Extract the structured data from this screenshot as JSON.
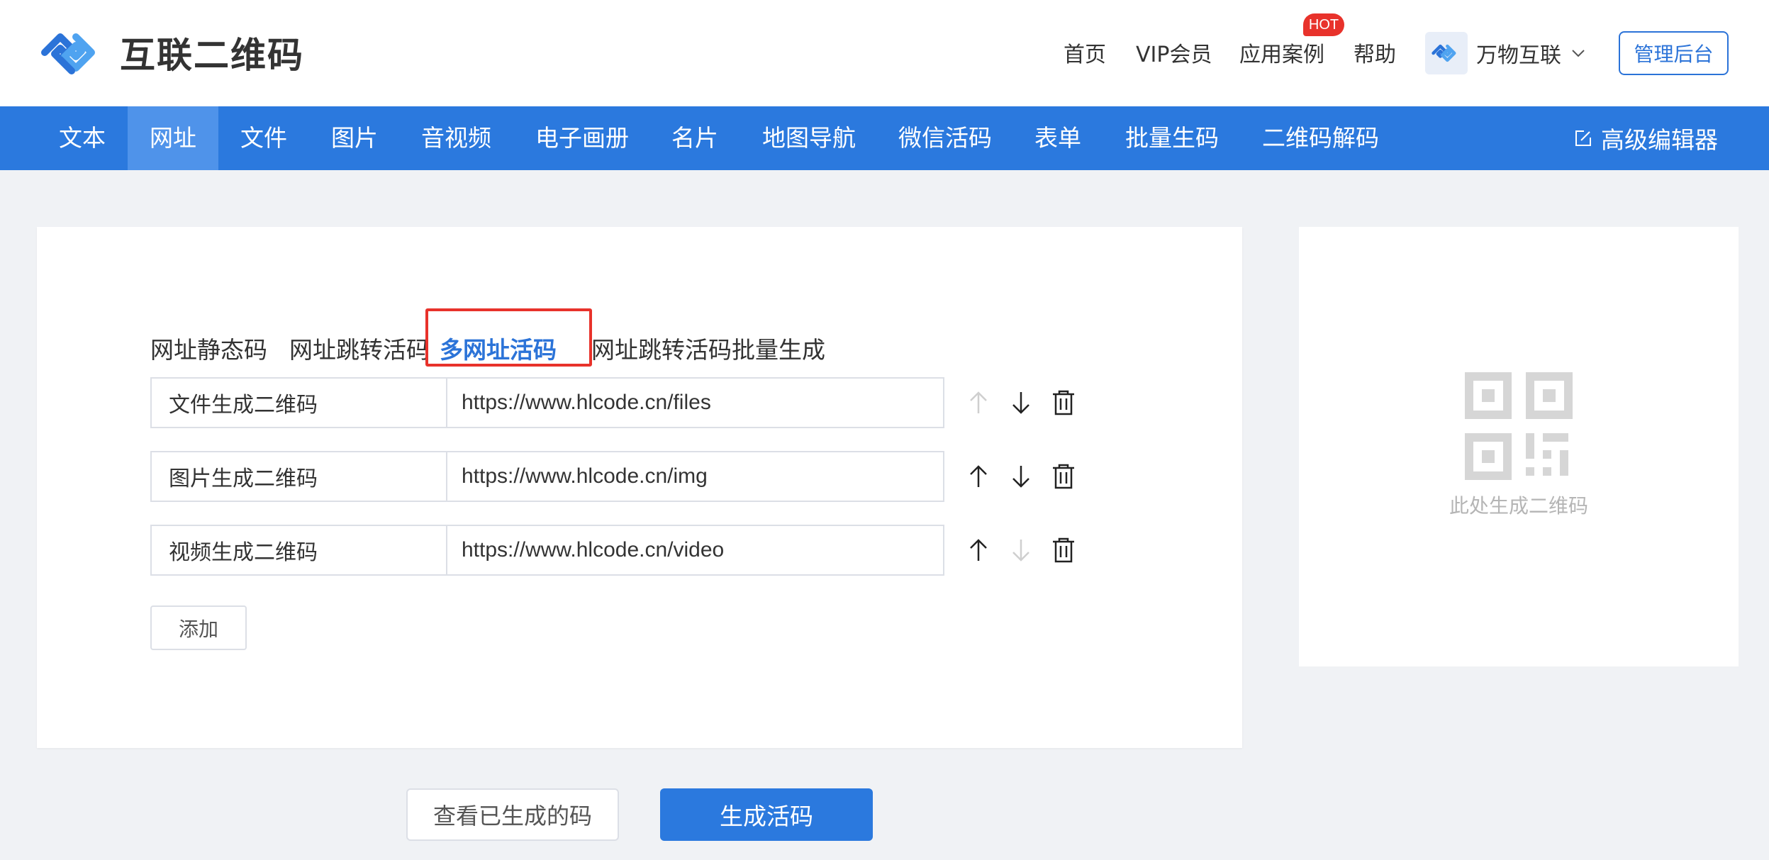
{
  "brand": {
    "name": "互联二维码",
    "accent": "#2b79de",
    "logo_icon": "chain-link-logo-icon"
  },
  "topnav": {
    "items": [
      "首页",
      "VIP会员",
      "应用案例",
      "帮助"
    ],
    "hot_badge": "HOT",
    "user_name": "万物互联",
    "admin_button": "管理后台"
  },
  "mainnav": {
    "items": [
      "文本",
      "网址",
      "文件",
      "图片",
      "音视频",
      "电子画册",
      "名片",
      "地图导航",
      "微信活码",
      "表单",
      "批量生码",
      "二维码解码"
    ],
    "active": "网址",
    "advanced_editor": "高级编辑器"
  },
  "subtabs": {
    "items": [
      "网址静态码",
      "网址跳转活码",
      "多网址活码",
      "网址跳转活码批量生成"
    ],
    "active": "多网址活码"
  },
  "rows": [
    {
      "name": "文件生成二维码",
      "url": "https://www.hlcode.cn/files",
      "up_enabled": false,
      "down_enabled": true
    },
    {
      "name": "图片生成二维码",
      "url": "https://www.hlcode.cn/img",
      "up_enabled": true,
      "down_enabled": true
    },
    {
      "name": "视频生成二维码",
      "url": "https://www.hlcode.cn/video",
      "up_enabled": true,
      "down_enabled": false
    }
  ],
  "add_button": "添加",
  "preview": {
    "placeholder_text": "此处生成二维码"
  },
  "actions": {
    "view_generated": "查看已生成的码",
    "generate": "生成活码"
  }
}
